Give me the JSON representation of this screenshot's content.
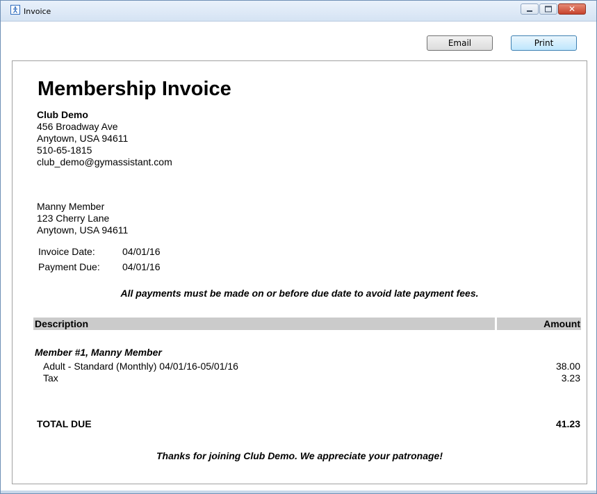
{
  "window": {
    "title": "Invoice",
    "close_glyph": "✕"
  },
  "toolbar": {
    "email_label": "Email",
    "print_label": "Print"
  },
  "invoice": {
    "title": "Membership Invoice",
    "club": {
      "name": "Club Demo",
      "address_line1": "456 Broadway Ave",
      "address_line2": "Anytown, USA 94611",
      "phone": "510-65-1815",
      "email": "club_demo@gymassistant.com"
    },
    "member": {
      "name": "Manny Member",
      "address_line1": "123 Cherry Lane",
      "address_line2": "Anytown, USA 94611"
    },
    "dates": {
      "invoice_date_label": "Invoice Date:",
      "invoice_date": "04/01/16",
      "payment_due_label": "Payment Due:",
      "payment_due": "04/01/16"
    },
    "notice": "All payments must be made on or before due date to avoid late payment fees.",
    "table": {
      "description_header": "Description",
      "amount_header": "Amount",
      "member_heading": "Member #1, Manny Member",
      "items": [
        {
          "description": "Adult - Standard (Monthly) 04/01/16-05/01/16",
          "amount": "38.00"
        },
        {
          "description": "Tax",
          "amount": "3.23"
        }
      ]
    },
    "total_label": "TOTAL DUE",
    "total_amount": "41.23",
    "thanks": "Thanks for joining Club Demo. We appreciate your patronage!"
  },
  "icons": {
    "app": "app-icon",
    "minimize": "minimize-icon",
    "maximize": "maximize-icon",
    "close": "close-icon"
  }
}
